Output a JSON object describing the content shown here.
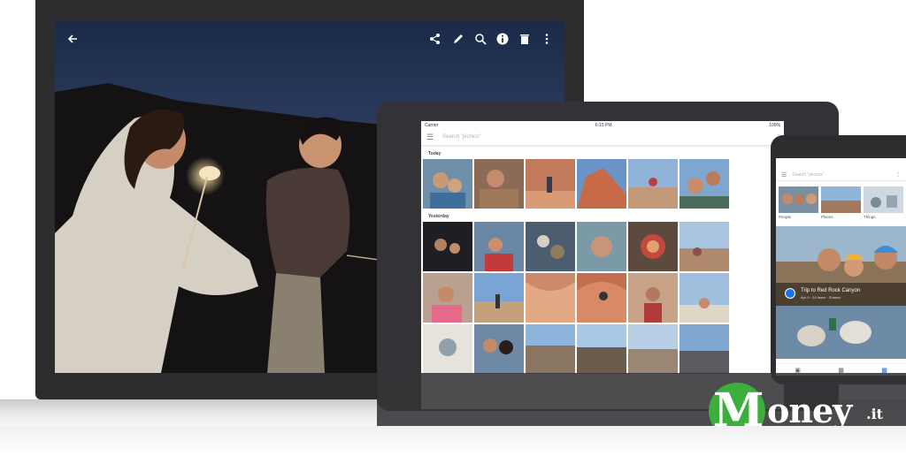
{
  "laptop": {
    "toolbar": {
      "back_icon": "arrow-back-icon",
      "icons": [
        "share-icon",
        "edit-icon",
        "zoom-icon",
        "info-icon",
        "delete-icon",
        "more-vert-icon"
      ]
    }
  },
  "tablet": {
    "status": {
      "carrier": "Carrier",
      "time": "6:15 PM",
      "battery": "100%"
    },
    "search": {
      "placeholder": "Search \"picnics\""
    },
    "sections": [
      {
        "label": "Today"
      },
      {
        "label": "Yesterday"
      }
    ]
  },
  "phone": {
    "search": {
      "placeholder": "Search \"picnics\""
    },
    "categories": [
      {
        "label": "People"
      },
      {
        "label": "Places"
      },
      {
        "label": "Things"
      }
    ],
    "card": {
      "title": "Trip to Red Rock Canyon",
      "subtitle": "Apr 9 · 24 items · Shared"
    }
  },
  "watermark": {
    "brand_initial": "M",
    "brand_rest": "oney",
    "brand_tld": ".it",
    "colors": {
      "circle": "#3cae3c",
      "text": "#ffffff",
      "banner": "#343438"
    }
  }
}
